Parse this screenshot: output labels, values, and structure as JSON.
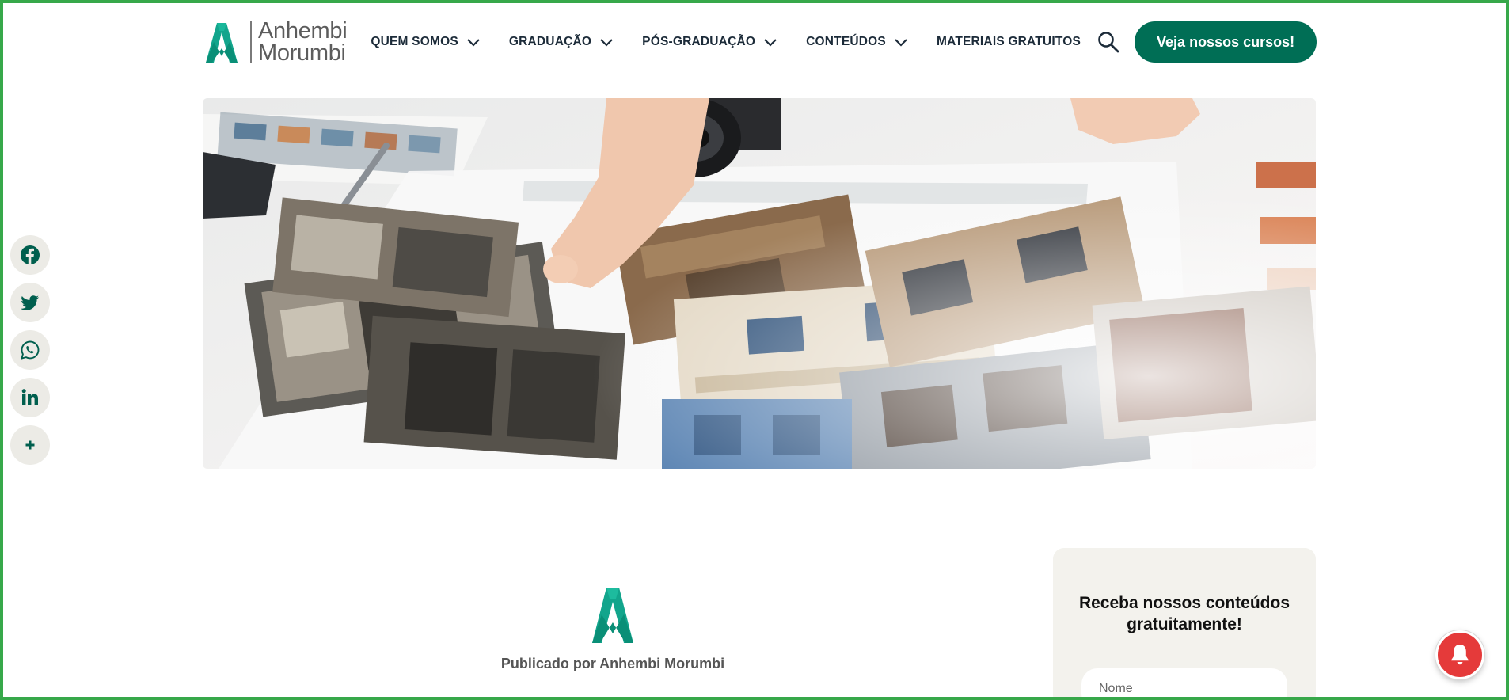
{
  "header": {
    "logo": {
      "line1": "Anhembi",
      "line2": "Morumbi"
    },
    "nav": [
      {
        "label": "QUEM SOMOS",
        "has_dropdown": true
      },
      {
        "label": "GRADUAÇÃO",
        "has_dropdown": true
      },
      {
        "label": "PÓS-GRADUAÇÃO",
        "has_dropdown": true
      },
      {
        "label": "CONTEÚDOS",
        "has_dropdown": true
      },
      {
        "label": "MATERIAIS GRATUITOS",
        "has_dropdown": false
      }
    ],
    "search_icon": "search-icon",
    "cta_label": "Veja nossos cursos!"
  },
  "share": {
    "icons": [
      "facebook-icon",
      "twitter-icon",
      "whatsapp-icon",
      "linkedin-icon",
      "plus-icon"
    ]
  },
  "author": {
    "published_by": "Publicado por Anhembi Morumbi"
  },
  "newsletter": {
    "title": "Receba nossos conteúdos gratuitamente!",
    "name_placeholder": "Nome"
  },
  "colors": {
    "brand_green": "#006e55",
    "logo_teal": "#12a58c",
    "frame_green": "#37a84a",
    "notification_red": "#e53a3a",
    "share_bg": "#ecebe6",
    "sidebar_bg": "#f3f2ed"
  }
}
